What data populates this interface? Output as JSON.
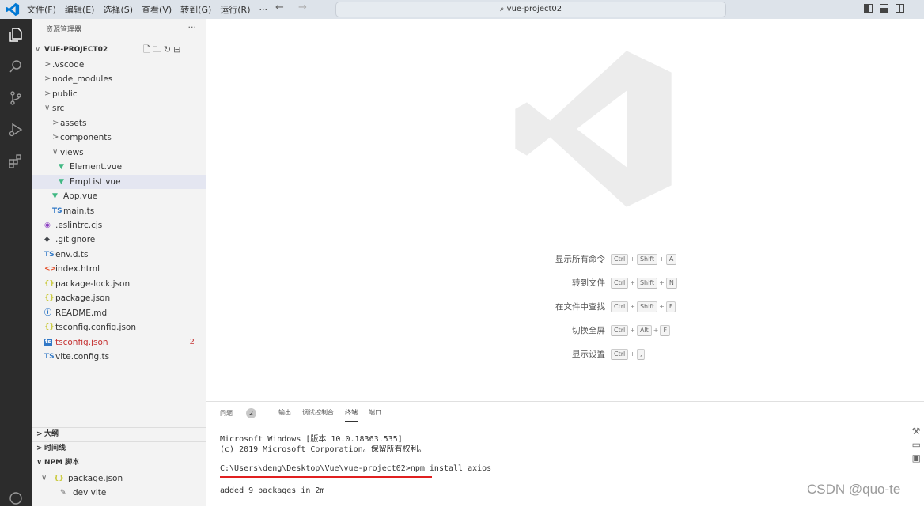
{
  "menu": [
    "文件(F)",
    "编辑(E)",
    "选择(S)",
    "查看(V)",
    "转到(G)",
    "运行(R)",
    "···"
  ],
  "nav": {
    "back": "←",
    "forward": "→"
  },
  "command_center": {
    "icon": "⌕",
    "text": "vue-project02"
  },
  "sidebar": {
    "title": "资源管理器",
    "more": "···",
    "project": "VUE-PROJECT02",
    "project_actions": [
      "new-file-icon",
      "new-folder-icon",
      "refresh-icon",
      "collapse-icon"
    ],
    "tree": [
      {
        "name": ".vscode",
        "twisty": ">",
        "icon": "",
        "depth": 1
      },
      {
        "name": "node_modules",
        "twisty": ">",
        "icon": "",
        "depth": 1
      },
      {
        "name": "public",
        "twisty": ">",
        "icon": "",
        "depth": 1
      },
      {
        "name": "src",
        "twisty": "∨",
        "icon": "",
        "depth": 1
      },
      {
        "name": "assets",
        "twisty": ">",
        "icon": "",
        "depth": 2
      },
      {
        "name": "components",
        "twisty": ">",
        "icon": "",
        "depth": 2
      },
      {
        "name": "views",
        "twisty": "∨",
        "icon": "",
        "depth": 2
      },
      {
        "name": "Element.vue",
        "twisty": "",
        "icon": "vue",
        "depth": 3
      },
      {
        "name": "EmpList.vue",
        "twisty": "",
        "icon": "vue",
        "depth": 3,
        "selected": true
      },
      {
        "name": "App.vue",
        "twisty": "",
        "icon": "vue",
        "depth": 2
      },
      {
        "name": "main.ts",
        "twisty": "",
        "icon": "ts",
        "depth": 2
      },
      {
        "name": ".eslintrc.cjs",
        "twisty": "",
        "icon": "eslint",
        "depth": 1
      },
      {
        "name": ".gitignore",
        "twisty": "",
        "icon": "git",
        "depth": 1
      },
      {
        "name": "env.d.ts",
        "twisty": "",
        "icon": "ts",
        "depth": 1
      },
      {
        "name": "index.html",
        "twisty": "",
        "icon": "html",
        "depth": 1
      },
      {
        "name": "package-lock.json",
        "twisty": "",
        "icon": "json",
        "depth": 1
      },
      {
        "name": "package.json",
        "twisty": "",
        "icon": "json",
        "depth": 1
      },
      {
        "name": "README.md",
        "twisty": "",
        "icon": "info",
        "depth": 1
      },
      {
        "name": "tsconfig.config.json",
        "twisty": "",
        "icon": "json",
        "depth": 1
      },
      {
        "name": "tsconfig.json",
        "twisty": "",
        "icon": "tsconfig",
        "depth": 1,
        "error": true,
        "badge": "2"
      },
      {
        "name": "vite.config.ts",
        "twisty": "",
        "icon": "ts",
        "depth": 1
      }
    ],
    "sections": [
      {
        "twisty": ">",
        "label": "大纲"
      },
      {
        "twisty": ">",
        "label": "时间线"
      },
      {
        "twisty": "∨",
        "label": "NPM 脚本"
      }
    ],
    "npm": {
      "package": "package.json",
      "script": "dev vite"
    }
  },
  "icon_glyphs": {
    "vue": "▼",
    "ts": "TS",
    "eslint": "◉",
    "git": "◆",
    "html": "<>",
    "json": "{}",
    "info": "ⓘ",
    "tsconfig": "ts"
  },
  "icon_colors": {
    "vue": "#41b883",
    "ts": "#3178c6",
    "eslint": "#8b3fc2",
    "git": "#41454a",
    "html": "#e44d26",
    "json": "#cbcb41",
    "info": "#3178c6",
    "tsconfig": "#3178c6"
  },
  "shortcuts": [
    {
      "label": "显示所有命令",
      "keys": [
        "Ctrl",
        "Shift",
        "A"
      ]
    },
    {
      "label": "转到文件",
      "keys": [
        "Ctrl",
        "Shift",
        "N"
      ]
    },
    {
      "label": "在文件中查找",
      "keys": [
        "Ctrl",
        "Shift",
        "F"
      ]
    },
    {
      "label": "切换全屏",
      "keys": [
        "Ctrl",
        "Alt",
        "F"
      ]
    },
    {
      "label": "显示设置",
      "keys": [
        "Ctrl",
        ","
      ]
    }
  ],
  "panel": {
    "tabs": [
      "问题",
      "输出",
      "调试控制台",
      "终端",
      "端口"
    ],
    "problem_count": "2",
    "active_tab": "终端",
    "terminal": [
      "Microsoft Windows [版本 10.0.18363.535]",
      "(c) 2019 Microsoft Corporation。保留所有权利。",
      "C:\\Users\\deng\\Desktop\\Vue\\vue-project02>npm install axios",
      "added 9 packages in 2m"
    ]
  },
  "watermark": "CSDN @quo-te",
  "colors": {
    "accent": "#007acc",
    "activity_bar": "#2c2c2c",
    "sidebar": "#f3f3f3",
    "error": "#c53030",
    "underline": "#e02020"
  }
}
